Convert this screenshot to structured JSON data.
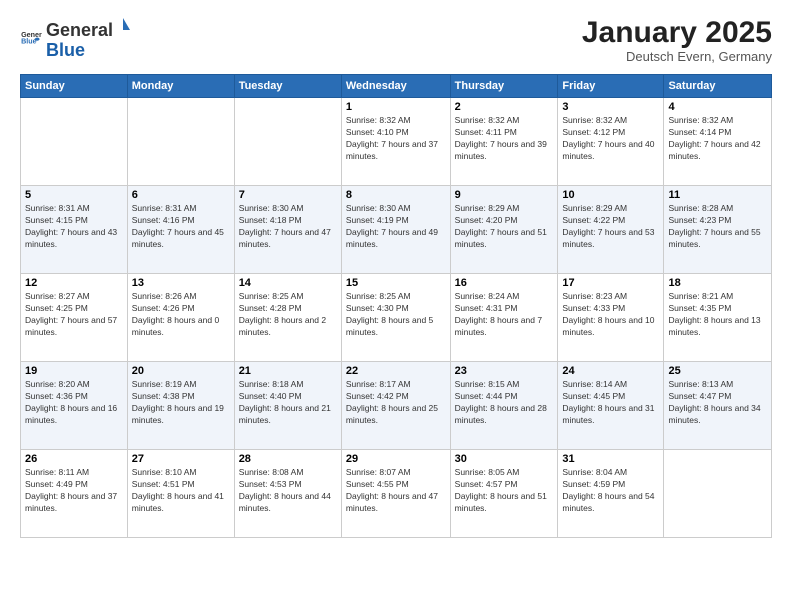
{
  "logo": {
    "general": "General",
    "blue": "Blue"
  },
  "title": "January 2025",
  "subtitle": "Deutsch Evern, Germany",
  "days_of_week": [
    "Sunday",
    "Monday",
    "Tuesday",
    "Wednesday",
    "Thursday",
    "Friday",
    "Saturday"
  ],
  "weeks": [
    [
      {
        "day": "",
        "info": ""
      },
      {
        "day": "",
        "info": ""
      },
      {
        "day": "",
        "info": ""
      },
      {
        "day": "1",
        "info": "Sunrise: 8:32 AM\nSunset: 4:10 PM\nDaylight: 7 hours and 37 minutes."
      },
      {
        "day": "2",
        "info": "Sunrise: 8:32 AM\nSunset: 4:11 PM\nDaylight: 7 hours and 39 minutes."
      },
      {
        "day": "3",
        "info": "Sunrise: 8:32 AM\nSunset: 4:12 PM\nDaylight: 7 hours and 40 minutes."
      },
      {
        "day": "4",
        "info": "Sunrise: 8:32 AM\nSunset: 4:14 PM\nDaylight: 7 hours and 42 minutes."
      }
    ],
    [
      {
        "day": "5",
        "info": "Sunrise: 8:31 AM\nSunset: 4:15 PM\nDaylight: 7 hours and 43 minutes."
      },
      {
        "day": "6",
        "info": "Sunrise: 8:31 AM\nSunset: 4:16 PM\nDaylight: 7 hours and 45 minutes."
      },
      {
        "day": "7",
        "info": "Sunrise: 8:30 AM\nSunset: 4:18 PM\nDaylight: 7 hours and 47 minutes."
      },
      {
        "day": "8",
        "info": "Sunrise: 8:30 AM\nSunset: 4:19 PM\nDaylight: 7 hours and 49 minutes."
      },
      {
        "day": "9",
        "info": "Sunrise: 8:29 AM\nSunset: 4:20 PM\nDaylight: 7 hours and 51 minutes."
      },
      {
        "day": "10",
        "info": "Sunrise: 8:29 AM\nSunset: 4:22 PM\nDaylight: 7 hours and 53 minutes."
      },
      {
        "day": "11",
        "info": "Sunrise: 8:28 AM\nSunset: 4:23 PM\nDaylight: 7 hours and 55 minutes."
      }
    ],
    [
      {
        "day": "12",
        "info": "Sunrise: 8:27 AM\nSunset: 4:25 PM\nDaylight: 7 hours and 57 minutes."
      },
      {
        "day": "13",
        "info": "Sunrise: 8:26 AM\nSunset: 4:26 PM\nDaylight: 8 hours and 0 minutes."
      },
      {
        "day": "14",
        "info": "Sunrise: 8:25 AM\nSunset: 4:28 PM\nDaylight: 8 hours and 2 minutes."
      },
      {
        "day": "15",
        "info": "Sunrise: 8:25 AM\nSunset: 4:30 PM\nDaylight: 8 hours and 5 minutes."
      },
      {
        "day": "16",
        "info": "Sunrise: 8:24 AM\nSunset: 4:31 PM\nDaylight: 8 hours and 7 minutes."
      },
      {
        "day": "17",
        "info": "Sunrise: 8:23 AM\nSunset: 4:33 PM\nDaylight: 8 hours and 10 minutes."
      },
      {
        "day": "18",
        "info": "Sunrise: 8:21 AM\nSunset: 4:35 PM\nDaylight: 8 hours and 13 minutes."
      }
    ],
    [
      {
        "day": "19",
        "info": "Sunrise: 8:20 AM\nSunset: 4:36 PM\nDaylight: 8 hours and 16 minutes."
      },
      {
        "day": "20",
        "info": "Sunrise: 8:19 AM\nSunset: 4:38 PM\nDaylight: 8 hours and 19 minutes."
      },
      {
        "day": "21",
        "info": "Sunrise: 8:18 AM\nSunset: 4:40 PM\nDaylight: 8 hours and 21 minutes."
      },
      {
        "day": "22",
        "info": "Sunrise: 8:17 AM\nSunset: 4:42 PM\nDaylight: 8 hours and 25 minutes."
      },
      {
        "day": "23",
        "info": "Sunrise: 8:15 AM\nSunset: 4:44 PM\nDaylight: 8 hours and 28 minutes."
      },
      {
        "day": "24",
        "info": "Sunrise: 8:14 AM\nSunset: 4:45 PM\nDaylight: 8 hours and 31 minutes."
      },
      {
        "day": "25",
        "info": "Sunrise: 8:13 AM\nSunset: 4:47 PM\nDaylight: 8 hours and 34 minutes."
      }
    ],
    [
      {
        "day": "26",
        "info": "Sunrise: 8:11 AM\nSunset: 4:49 PM\nDaylight: 8 hours and 37 minutes."
      },
      {
        "day": "27",
        "info": "Sunrise: 8:10 AM\nSunset: 4:51 PM\nDaylight: 8 hours and 41 minutes."
      },
      {
        "day": "28",
        "info": "Sunrise: 8:08 AM\nSunset: 4:53 PM\nDaylight: 8 hours and 44 minutes."
      },
      {
        "day": "29",
        "info": "Sunrise: 8:07 AM\nSunset: 4:55 PM\nDaylight: 8 hours and 47 minutes."
      },
      {
        "day": "30",
        "info": "Sunrise: 8:05 AM\nSunset: 4:57 PM\nDaylight: 8 hours and 51 minutes."
      },
      {
        "day": "31",
        "info": "Sunrise: 8:04 AM\nSunset: 4:59 PM\nDaylight: 8 hours and 54 minutes."
      },
      {
        "day": "",
        "info": ""
      }
    ]
  ]
}
